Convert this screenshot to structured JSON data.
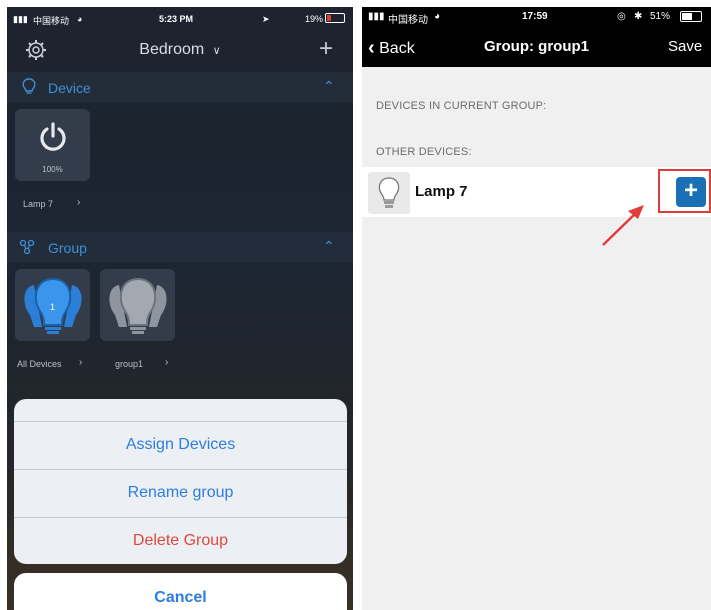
{
  "left": {
    "status": {
      "carrier": "中国移动",
      "time": "5:23 PM",
      "battery": "19%"
    },
    "navbar": {
      "title": "Bedroom",
      "dropdown_icon": "chevron-down-icon",
      "settings_icon": "gear-icon",
      "add_icon": "plus-icon"
    },
    "device_section": {
      "title": "Device",
      "device": {
        "level": "100%",
        "name": "Lamp 7"
      }
    },
    "group_section": {
      "title": "Group",
      "groups": [
        {
          "name": "All Devices",
          "count": "1"
        },
        {
          "name": "group1"
        }
      ]
    },
    "action_sheet": {
      "items": [
        "Assign Devices",
        "Rename group",
        "Delete Group"
      ],
      "cancel": "Cancel"
    }
  },
  "right": {
    "status": {
      "carrier": "中国移动",
      "time": "17:59",
      "battery": "51%"
    },
    "navbar": {
      "back": "Back",
      "title": "Group: group1",
      "save": "Save"
    },
    "current_header": "DEVICES IN CURRENT GROUP:",
    "other_header": "OTHER DEVICES:",
    "devices": [
      {
        "name": "Lamp 7"
      }
    ],
    "add_button": "+"
  },
  "colors": {
    "accent_blue": "#2f7de1",
    "delete_red": "#e0483e",
    "highlight_red": "#e23b3b",
    "add_button_blue": "#1b6fb5"
  }
}
